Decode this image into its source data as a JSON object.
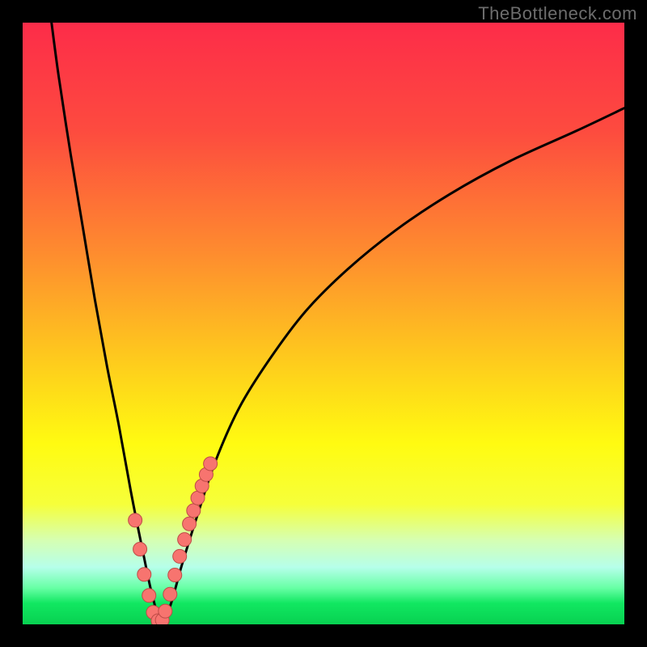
{
  "watermark": "TheBottleneck.com",
  "colors": {
    "frame": "#000000",
    "gradient_stops": [
      {
        "offset": 0.0,
        "color": "#fd2c49"
      },
      {
        "offset": 0.18,
        "color": "#fd4b3f"
      },
      {
        "offset": 0.38,
        "color": "#fe8b2f"
      },
      {
        "offset": 0.55,
        "color": "#fec71e"
      },
      {
        "offset": 0.7,
        "color": "#fffb11"
      },
      {
        "offset": 0.8,
        "color": "#f6ff3a"
      },
      {
        "offset": 0.86,
        "color": "#d6ffb2"
      },
      {
        "offset": 0.905,
        "color": "#b6ffea"
      },
      {
        "offset": 0.94,
        "color": "#66ffa4"
      },
      {
        "offset": 0.965,
        "color": "#11e761"
      },
      {
        "offset": 1.0,
        "color": "#08d151"
      }
    ],
    "curve": "#000000",
    "marker_fill": "#f7746f",
    "marker_stroke": "#be4b47"
  },
  "chart_data": {
    "type": "line",
    "title": "",
    "xlabel": "",
    "ylabel": "",
    "x_range": [
      0,
      100
    ],
    "y_range": [
      0,
      100
    ],
    "series": [
      {
        "name": "bottleneck-curve",
        "x": [
          4.8,
          6,
          8,
          10,
          12,
          14,
          16,
          18,
          20,
          21.5,
          23,
          24.5,
          26.5,
          29,
          32,
          36,
          41,
          47,
          54,
          62,
          71,
          81,
          92,
          100
        ],
        "y": [
          100,
          91,
          78,
          66,
          54,
          43,
          33,
          22,
          12,
          5,
          0.5,
          3,
          10,
          18,
          27,
          36,
          44,
          52,
          59,
          65.5,
          71.5,
          77,
          82,
          85.8
        ]
      }
    ],
    "markers": {
      "name": "highlighted-points",
      "x": [
        18.7,
        19.5,
        20.2,
        21.0,
        21.7,
        22.5,
        23.2,
        23.7,
        24.5,
        25.3,
        26.1,
        26.9,
        27.7,
        28.4,
        29.1,
        29.8,
        30.5,
        31.2
      ],
      "y": [
        17.3,
        12.5,
        8.3,
        4.8,
        2.0,
        0.6,
        0.7,
        2.2,
        5.0,
        8.2,
        11.3,
        14.1,
        16.7,
        18.9,
        21.0,
        23.0,
        24.9,
        26.7
      ]
    }
  }
}
